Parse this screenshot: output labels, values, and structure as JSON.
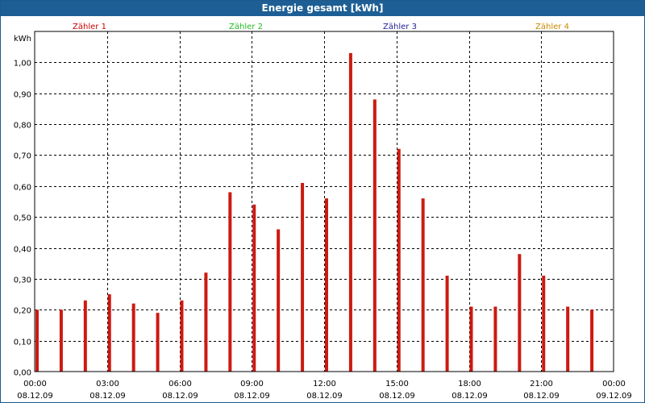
{
  "window": {
    "title": "Energie gesamt [kWh]"
  },
  "legend": [
    {
      "name": "Zähler 1",
      "color": "#cc0000"
    },
    {
      "name": "Zähler 2",
      "color": "#22bb22"
    },
    {
      "name": "Zähler 3",
      "color": "#222299"
    },
    {
      "name": "Zähler 4",
      "color": "#cc8800"
    }
  ],
  "chart_data": {
    "type": "bar",
    "title": "Energie gesamt [kWh]",
    "ylabel": "kWh",
    "ylim": [
      0,
      1.1
    ],
    "y_ticks": [
      "0,00",
      "0,10",
      "0,20",
      "0,30",
      "0,40",
      "0,50",
      "0,60",
      "0,70",
      "0,80",
      "0,90",
      "1,00"
    ],
    "y_tick_values": [
      0,
      0.1,
      0.2,
      0.3,
      0.4,
      0.5,
      0.6,
      0.7,
      0.8,
      0.9,
      1.0
    ],
    "x_ticks": [
      {
        "time": "00:00",
        "date": "08.12.09",
        "hour": 0
      },
      {
        "time": "03:00",
        "date": "08.12.09",
        "hour": 3
      },
      {
        "time": "06:00",
        "date": "08.12.09",
        "hour": 6
      },
      {
        "time": "09:00",
        "date": "08.12.09",
        "hour": 9
      },
      {
        "time": "12:00",
        "date": "08.12.09",
        "hour": 12
      },
      {
        "time": "15:00",
        "date": "08.12.09",
        "hour": 15
      },
      {
        "time": "18:00",
        "date": "08.12.09",
        "hour": 18
      },
      {
        "time": "21:00",
        "date": "08.12.09",
        "hour": 21
      },
      {
        "time": "00:00",
        "date": "09.12.09",
        "hour": 24
      }
    ],
    "xlim_hours": [
      0,
      24
    ],
    "grid": true,
    "legend_position": "top",
    "bar_color": "#cc1a10",
    "series": [
      {
        "name": "Zähler 1",
        "hours": [
          0,
          1,
          2,
          3,
          4,
          5,
          6,
          7,
          8,
          9,
          10,
          11,
          12,
          13,
          14,
          15,
          16,
          17,
          18,
          19,
          20,
          21,
          22,
          23
        ],
        "values": [
          0.2,
          0.2,
          0.23,
          0.25,
          0.22,
          0.19,
          0.23,
          0.32,
          0.58,
          0.54,
          0.46,
          0.61,
          0.56,
          1.03,
          0.88,
          0.72,
          0.56,
          0.31,
          0.21,
          0.21,
          0.38,
          0.31,
          0.21,
          0.2
        ]
      }
    ]
  }
}
